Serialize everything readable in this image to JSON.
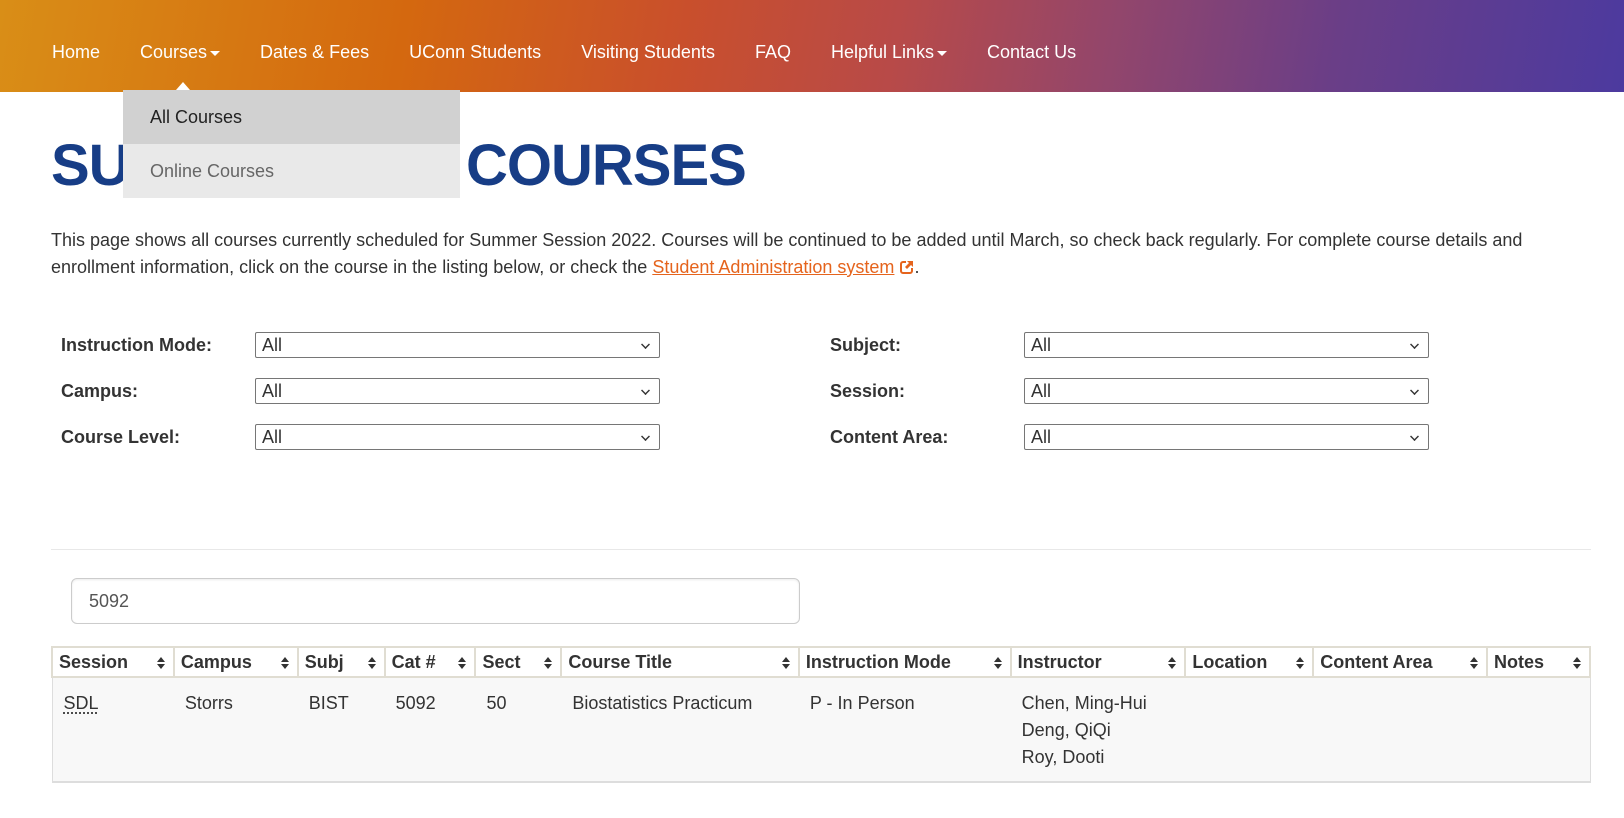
{
  "nav": {
    "items": [
      {
        "label": "Home",
        "has_dropdown": false
      },
      {
        "label": "Courses",
        "has_dropdown": true
      },
      {
        "label": "Dates & Fees",
        "has_dropdown": false
      },
      {
        "label": "UConn Students",
        "has_dropdown": false
      },
      {
        "label": "Visiting Students",
        "has_dropdown": false
      },
      {
        "label": "FAQ",
        "has_dropdown": false
      },
      {
        "label": "Helpful Links",
        "has_dropdown": true
      },
      {
        "label": "Contact Us",
        "has_dropdown": false
      }
    ],
    "courses_dropdown": {
      "items": [
        {
          "label": "All Courses",
          "active": true
        },
        {
          "label": "Online Courses",
          "active": false
        }
      ]
    }
  },
  "page": {
    "title_visible_left": "SU",
    "title_visible_right": "COURSES",
    "intro_text_1": "This page shows all courses currently scheduled for Summer Session 2022. Courses will be continued to be added until March, so check back regularly. For complete course details and enrollment information, click on the course in the listing below, or check the ",
    "intro_link": "Student Administration system",
    "intro_text_2": ".",
    "external_link_icon": "external-link-icon"
  },
  "filters": {
    "instruction_mode": {
      "label": "Instruction Mode:",
      "value": "All"
    },
    "campus": {
      "label": "Campus:",
      "value": "All"
    },
    "course_level": {
      "label": "Course Level:",
      "value": "All"
    },
    "subject": {
      "label": "Subject:",
      "value": "All"
    },
    "session": {
      "label": "Session:",
      "value": "All"
    },
    "content_area": {
      "label": "Content Area:",
      "value": "All"
    }
  },
  "search": {
    "value": "5092"
  },
  "table": {
    "columns": [
      "Session",
      "Campus",
      "Subj",
      "Cat #",
      "Sect",
      "Course Title",
      "Instruction Mode",
      "Instructor",
      "Location",
      "Content Area",
      "Notes"
    ],
    "rows": [
      {
        "session": "SDL",
        "campus": "Storrs",
        "subj": "BIST",
        "cat": "5092",
        "sect": "50",
        "title": "Biostatistics Practicum",
        "mode": "P - In Person",
        "instructors": [
          "Chen, Ming-Hui",
          "Deng, QiQi",
          "Roy, Dooti"
        ],
        "location": "",
        "content_area": "",
        "notes": ""
      }
    ]
  },
  "colors": {
    "title_blue": "#173d86",
    "link_orange": "#e5641d",
    "nav_gradient_start": "#d98e17",
    "nav_gradient_end": "#4c3a9f"
  }
}
